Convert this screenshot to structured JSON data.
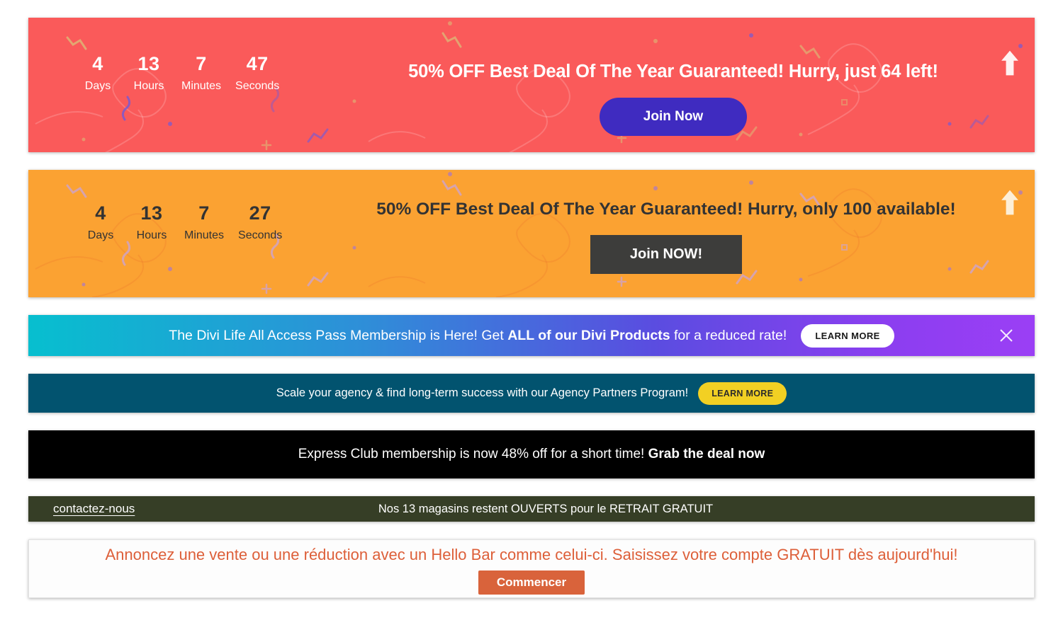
{
  "banners": [
    {
      "id": "coral-countdown-bar",
      "bg_color": "#FA5A5A",
      "countdown": [
        {
          "value": "4",
          "label": "Days"
        },
        {
          "value": "13",
          "label": "Hours"
        },
        {
          "value": "7",
          "label": "Minutes"
        },
        {
          "value": "47",
          "label": "Seconds"
        }
      ],
      "headline": "50% OFF Best Deal Of The Year Guaranteed! Hurry, just 64 left!",
      "button_label": "Join Now",
      "button_color": "#3F2BC0",
      "scroll_icon": "arrow-up-icon"
    },
    {
      "id": "orange-countdown-bar",
      "bg_color": "#FBA232",
      "countdown": [
        {
          "value": "4",
          "label": "Days"
        },
        {
          "value": "13",
          "label": "Hours"
        },
        {
          "value": "7",
          "label": "Minutes"
        },
        {
          "value": "27",
          "label": "Seconds"
        }
      ],
      "headline": "50% OFF Best Deal Of The Year Guaranteed! Hurry, only 100 available!",
      "button_label": "Join NOW!",
      "button_color": "#3D3D3B",
      "scroll_icon": "arrow-up-icon"
    },
    {
      "id": "divi-gradient-bar",
      "gradient_start": "#07BFCF",
      "gradient_end": "#9B3FF5",
      "text_lead": "The Divi Life All Access Pass Membership is Here! Get ",
      "text_bold": "ALL of our Divi Products",
      "text_tail": " for a reduced rate!",
      "button_label": "LEARN MORE",
      "close_icon": "close-icon"
    },
    {
      "id": "agency-partners-bar",
      "bg_color": "#02536F",
      "text": "Scale your agency & find long-term success with our Agency Partners Program!",
      "button_label": "LEARN MORE",
      "button_color": "#F2D023"
    },
    {
      "id": "express-club-bar",
      "bg_color": "#000000",
      "text_lead": "Express Club membership is now 48% off for a short time! ",
      "text_bold": "Grab the deal now"
    },
    {
      "id": "french-stores-bar",
      "bg_color": "#363E26",
      "link_label": "contactez-nous",
      "text": "Nos 13 magasins restent OUVERTS pour le RETRAIT GRATUIT"
    },
    {
      "id": "hellobar-white-bar",
      "bg_color": "#FDFDFD",
      "text": "Annoncez une vente ou une réduction avec un Hello Bar comme celui-ci. Saisissez votre compte GRATUIT dès aujourd'hui!",
      "text_color": "#DD5F39",
      "button_label": "Commencer",
      "button_color": "#D9633B"
    }
  ]
}
